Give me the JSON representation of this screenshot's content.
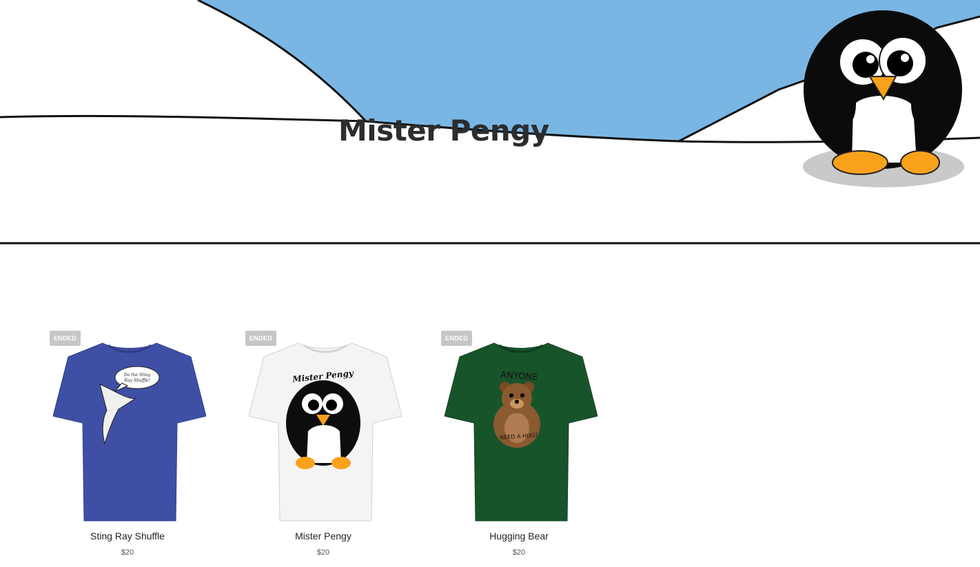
{
  "store": {
    "title": "Mister Pengy"
  },
  "colors": {
    "sky": "#7ab6e4",
    "badge": "#c4c6c8",
    "penguin_orange": "#f9a11b"
  },
  "products": [
    {
      "name": "Sting Ray Shuffle",
      "price": "$20",
      "status": "ENDED",
      "shirt_color": "#3f4fa5",
      "print_text": "Do the Sting Ray Shuffle!"
    },
    {
      "name": "Mister Pengy",
      "price": "$20",
      "status": "ENDED",
      "shirt_color": "#f4f4f4",
      "print_text": "Mister Pengy"
    },
    {
      "name": "Hugging Bear",
      "price": "$20",
      "status": "ENDED",
      "shirt_color": "#18542a",
      "print_text_top": "ANYONE",
      "print_text_bottom": "NEED A HUG?"
    }
  ]
}
